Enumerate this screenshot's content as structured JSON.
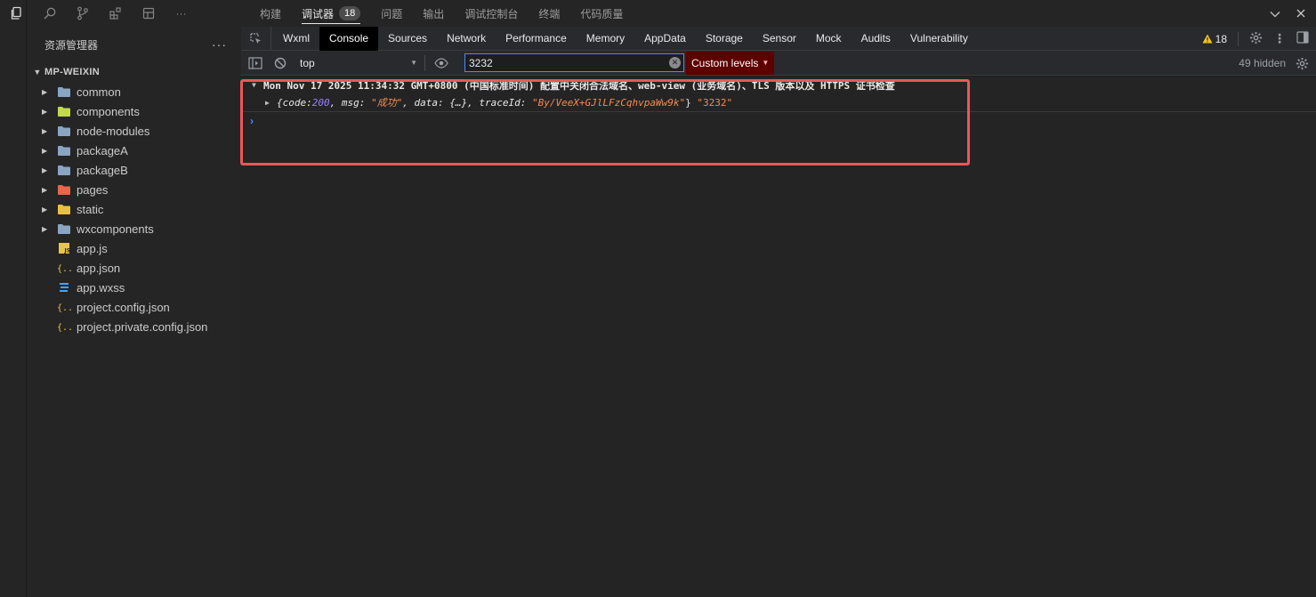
{
  "panel_tabs": [
    {
      "label": "构建"
    },
    {
      "label": "调试器",
      "badge": "18",
      "active": true
    },
    {
      "label": "问题"
    },
    {
      "label": "输出"
    },
    {
      "label": "调试控制台"
    },
    {
      "label": "终端"
    },
    {
      "label": "代码质量"
    }
  ],
  "sidebar": {
    "title": "资源管理器",
    "more": "···",
    "project": "MP-WEIXIN",
    "folders": [
      {
        "name": "common",
        "color": "#8aa5c2"
      },
      {
        "name": "components",
        "color": "#c2d94c"
      },
      {
        "name": "node-modules",
        "color": "#8aa5c2"
      },
      {
        "name": "packageA",
        "color": "#8aa5c2"
      },
      {
        "name": "packageB",
        "color": "#8aa5c2"
      },
      {
        "name": "pages",
        "color": "#e8664a"
      },
      {
        "name": "static",
        "color": "#e9c046"
      },
      {
        "name": "wxcomponents",
        "color": "#8aa5c2"
      }
    ],
    "files": [
      {
        "name": "app.js",
        "icon": "js-icon"
      },
      {
        "name": "app.json",
        "icon": "json-icon"
      },
      {
        "name": "app.wxss",
        "icon": "css-icon"
      },
      {
        "name": "project.config.json",
        "icon": "json-icon"
      },
      {
        "name": "project.private.config.json",
        "icon": "json-icon"
      }
    ]
  },
  "devtools": {
    "tabs": [
      "Wxml",
      "Console",
      "Sources",
      "Network",
      "Performance",
      "Memory",
      "AppData",
      "Storage",
      "Sensor",
      "Mock",
      "Audits",
      "Vulnerability"
    ],
    "active_tab": "Console",
    "warning_count": "18",
    "context": "top",
    "filter_value": "3232",
    "levels_label": "Custom levels",
    "hidden_label": "49 hidden"
  },
  "console": {
    "header": "Mon Nov 17 2025 11:34:32 GMT+0800 (中国标准时间) 配置中关闭合法域名、web-view (业务域名)、TLS 版本以及 HTTPS 证书检查",
    "obj_open": "{",
    "k_code": "code: ",
    "v_code": "200",
    "k_msg": ", msg: ",
    "v_msg": "\"成功\"",
    "k_data": ", data: ",
    "v_data": "{…}",
    "k_trace": ", traceId: ",
    "v_trace": "\"By/VeeX+GJlLFzCqhvpaWw9k\"",
    "obj_close": "}",
    "extra": " \"3232\"",
    "prompt": "›"
  }
}
